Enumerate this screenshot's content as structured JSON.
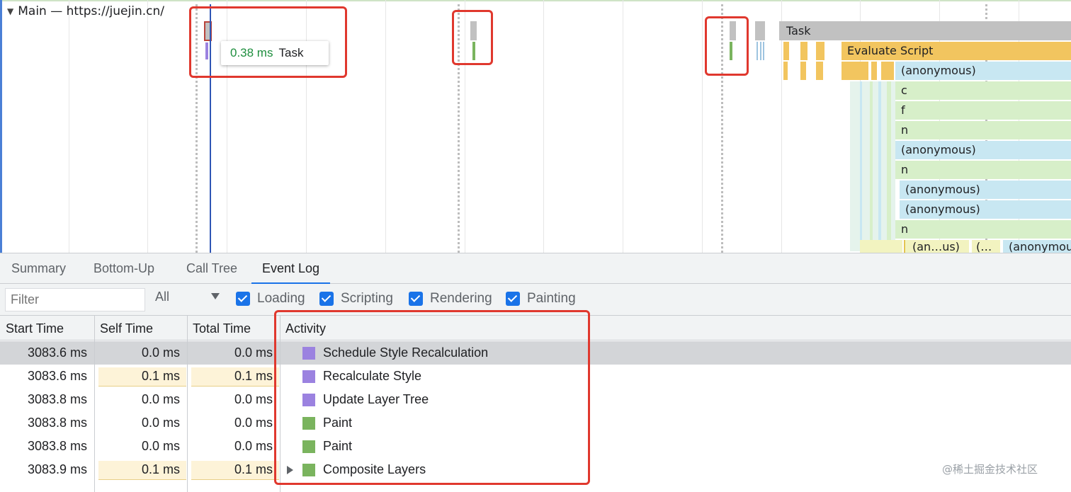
{
  "flame": {
    "track_title": "Main — https://juejin.cn/",
    "tooltip_ms": "0.38 ms",
    "tooltip_label": "Task",
    "labels": {
      "task": "Task",
      "evaluate_script": "Evaluate Script",
      "anon1": "(anonymous)",
      "c": "c",
      "f": "f",
      "n1": "n",
      "anon2": "(anonymous)",
      "n2": "n",
      "anon3": "(anonymous)",
      "anon4": "(anonymous)",
      "n3": "n",
      "bottom_a": "(an…us)",
      "bottom_b": "(…",
      "bottom_c": "(anonymous"
    },
    "colors": {
      "task": "#c1c1c1",
      "scripting": "#f2c55f",
      "js_blue": "#c8e7f2",
      "js_green": "#d7efc9",
      "paint": "#7ab45e",
      "rendering": "#9b82e0"
    }
  },
  "tabs": [
    "Summary",
    "Bottom-Up",
    "Call Tree",
    "Event Log"
  ],
  "active_tab": "Event Log",
  "toolbar": {
    "filter_placeholder": "Filter",
    "select_value": "All",
    "checkboxes": [
      "Loading",
      "Scripting",
      "Rendering",
      "Painting"
    ]
  },
  "table": {
    "headers": [
      "Start Time",
      "Self Time",
      "Total Time",
      "Activity"
    ],
    "rows": [
      {
        "start": "3083.6 ms",
        "self": "0.0 ms",
        "total": "0.0 ms",
        "activity": "Schedule Style Recalculation",
        "category": "rendering"
      },
      {
        "start": "3083.6 ms",
        "self": "0.1 ms",
        "total": "0.1 ms",
        "activity": "Recalculate Style",
        "category": "rendering"
      },
      {
        "start": "3083.8 ms",
        "self": "0.0 ms",
        "total": "0.0 ms",
        "activity": "Update Layer Tree",
        "category": "rendering"
      },
      {
        "start": "3083.8 ms",
        "self": "0.0 ms",
        "total": "0.0 ms",
        "activity": "Paint",
        "category": "painting"
      },
      {
        "start": "3083.8 ms",
        "self": "0.0 ms",
        "total": "0.0 ms",
        "activity": "Paint",
        "category": "painting"
      },
      {
        "start": "3083.9 ms",
        "self": "0.1 ms",
        "total": "0.1 ms",
        "activity": "Composite Layers",
        "category": "painting"
      }
    ]
  },
  "watermark": "@稀土掘金技术社区"
}
